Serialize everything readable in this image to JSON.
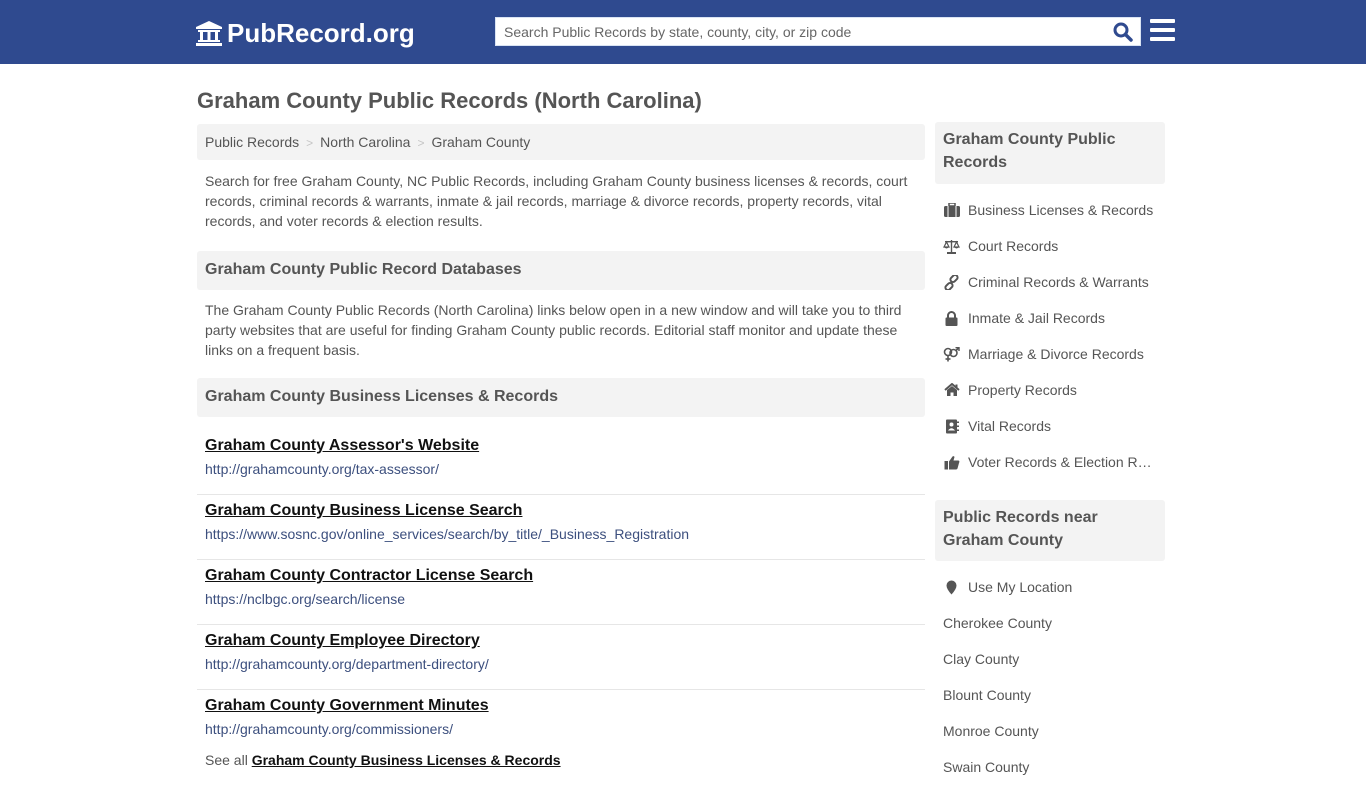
{
  "header": {
    "logo_text": "PubRecord.org",
    "search_placeholder": "Search Public Records by state, county, city, or zip code",
    "search_value": "",
    "colors": {
      "brand": "#2f4a8f",
      "search_icon": "#2f4a8f"
    }
  },
  "page": {
    "title": "Graham County Public Records (North Carolina)",
    "breadcrumb": [
      "Public Records",
      "North Carolina",
      "Graham County"
    ],
    "intro": "Search for free Graham County, NC Public Records, including Graham County business licenses & records, court records, criminal records & warrants, inmate & jail records, marriage & divorce records, property records, vital records, and voter records & election results."
  },
  "databases": {
    "heading": "Graham County Public Record Databases",
    "description": "The Graham County Public Records (North Carolina) links below open in a new window and will take you to third party websites that are useful for finding Graham County public records. Editorial staff monitor and update these links on a frequent basis."
  },
  "business": {
    "heading": "Graham County Business Licenses & Records",
    "links": [
      {
        "title": "Graham County Assessor's Website",
        "url": "http://grahamcounty.org/tax-assessor/"
      },
      {
        "title": "Graham County Business License Search",
        "url": "https://www.sosnc.gov/online_services/search/by_title/_Business_Registration"
      },
      {
        "title": "Graham County Contractor License Search",
        "url": "https://nclbgc.org/search/license"
      },
      {
        "title": "Graham County Employee Directory",
        "url": "http://grahamcounty.org/department-directory/"
      },
      {
        "title": "Graham County Government Minutes",
        "url": "http://grahamcounty.org/commissioners/"
      }
    ],
    "see_all_prefix": "See all",
    "see_all_link": "Graham County Business Licenses & Records"
  },
  "sidebar": {
    "records_heading": "Graham County Public Records",
    "records": [
      {
        "label": "Business Licenses & Records",
        "icon": "briefcase-icon"
      },
      {
        "label": "Court Records",
        "icon": "scales-icon"
      },
      {
        "label": "Criminal Records & Warrants",
        "icon": "link-icon"
      },
      {
        "label": "Inmate & Jail Records",
        "icon": "lock-icon"
      },
      {
        "label": "Marriage & Divorce Records",
        "icon": "gender-icon"
      },
      {
        "label": "Property Records",
        "icon": "home-icon"
      },
      {
        "label": "Vital Records",
        "icon": "contact-book-icon"
      },
      {
        "label": "Voter Records & Election Results",
        "icon": "thumbs-up-icon"
      }
    ],
    "nearby_heading": "Public Records near Graham County",
    "use_location": "Use My Location",
    "nearby": [
      "Cherokee County",
      "Clay County",
      "Blount County",
      "Monroe County",
      "Swain County"
    ]
  }
}
